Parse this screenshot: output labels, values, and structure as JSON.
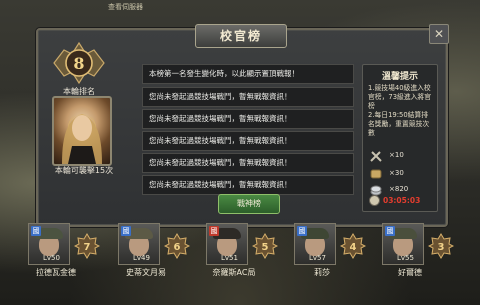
{
  "top_hint": "查看伺服器",
  "title": "校官榜",
  "close_label": "✕",
  "rank": {
    "number": "8",
    "label": "本輪排名"
  },
  "challenge_text": "本輪可襲擊15次",
  "news": {
    "first": "本榜第一名發生變化時，以此顯示置頂戰報！",
    "rows": [
      "您尚未發起過競技場戰鬥，暫無戰報資訊！",
      "您尚未發起過競技場戰鬥，暫無戰報資訊！",
      "您尚未發起過競技場戰鬥，暫無戰報資訊！",
      "您尚未發起過競技場戰鬥，暫無戰報資訊！",
      "您尚未發起過競技場戰鬥，暫無戰報資訊！"
    ]
  },
  "god_button": "戰神榜",
  "side": {
    "title": "溫馨提示",
    "text": "1.競技場40級進入校官榜，73級進入將官榜\n2.每日19:50結算排名獎勵，重置競技次數",
    "rewards": [
      {
        "icon": "swords-icon",
        "value": "×10"
      },
      {
        "icon": "scroll-icon",
        "value": "×30"
      },
      {
        "icon": "silver-coins-icon",
        "value": "×820"
      }
    ],
    "timer": "03:05:03"
  },
  "opponents": [
    {
      "name": "拉德瓦金德",
      "lv": "Lv50",
      "rank": "7",
      "flag": "國",
      "flag_color": "#3a6fc7"
    },
    {
      "name": "史蒂文月易",
      "lv": "Lv49",
      "rank": "6",
      "flag": "國",
      "flag_color": "#3a6fc7"
    },
    {
      "name": "奈羅斯AC局",
      "lv": "Lv51",
      "rank": "5",
      "flag": "國",
      "flag_color": "#c0392b"
    },
    {
      "name": "莉莎",
      "lv": "Lv57",
      "rank": "4",
      "flag": "國",
      "flag_color": "#3a6fc7"
    },
    {
      "name": "好爾德",
      "lv": "Lv55",
      "rank": "3",
      "flag": "國",
      "flag_color": "#3a6fc7"
    }
  ]
}
